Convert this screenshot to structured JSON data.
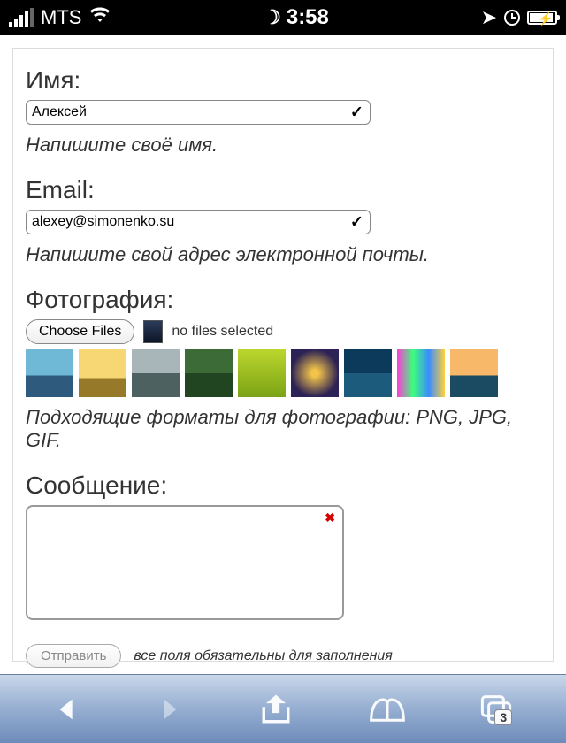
{
  "statusbar": {
    "carrier": "MTS",
    "time": "3:58"
  },
  "form": {
    "name": {
      "label": "Имя:",
      "value": "Алексей",
      "hint": "Напишите своё имя."
    },
    "email": {
      "label": "Email:",
      "value": "alexey@simonenko.su",
      "hint": "Напишите свой адрес электронной почты."
    },
    "photo": {
      "label": "Фотография:",
      "choose_label": "Choose Files",
      "status": "no files selected",
      "hint": "Подходящие форматы для фотографии: PNG, JPG, GIF."
    },
    "message": {
      "label": "Сообщение:",
      "value": ""
    },
    "submit": {
      "label": "Отправить",
      "note": "все поля обязательны для заполнения"
    }
  },
  "toolbar": {
    "tabs_count": "3"
  }
}
